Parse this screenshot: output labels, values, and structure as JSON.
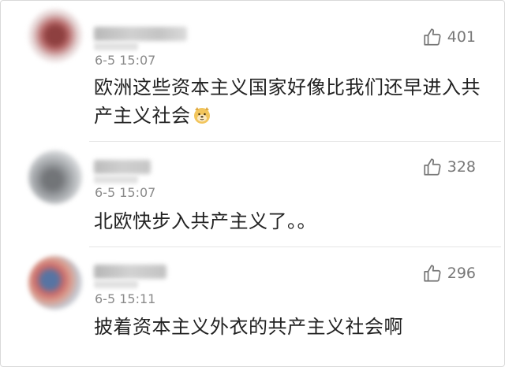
{
  "comments": [
    {
      "timestamp": "6-5 15:07",
      "text": "欧洲这些资本主义国家好像比我们还早进入共产主义社会",
      "emoji": "doge-emoji",
      "likes": "401"
    },
    {
      "timestamp": "6-5 15:07",
      "text": "北欧快步入共产主义了。。",
      "likes": "328"
    },
    {
      "timestamp": "6-5 15:11",
      "text": "披着资本主义外衣的共产主义社会啊",
      "likes": "296"
    }
  ],
  "icons": {
    "like": "thumbs-up-icon"
  },
  "colors": {
    "text": "#222222",
    "meta": "#8a8a8a",
    "like": "#777777",
    "divider": "#e5e5e5"
  }
}
